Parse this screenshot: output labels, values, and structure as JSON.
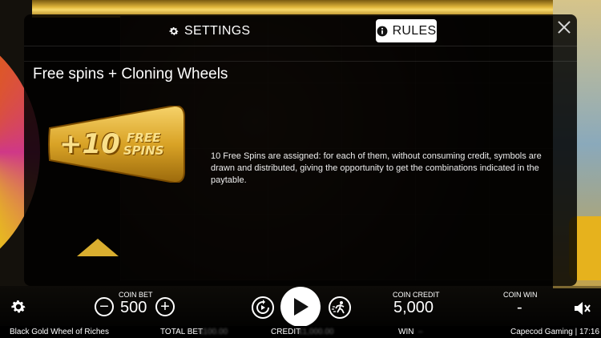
{
  "modal": {
    "tabs": [
      {
        "label": "SETTINGS",
        "icon": "gear-icon",
        "active": false
      },
      {
        "label": "RULES",
        "icon": "info-icon",
        "active": true
      }
    ],
    "close_icon": "close-icon",
    "heading": "Free spins + Cloning Wheels",
    "badge": {
      "number": "+10",
      "word1": "FREE",
      "word2": "SPINS"
    },
    "description": "10 Free Spins are assigned: for each of them, without consuming credit, symbols are drawn and distributed, giving the opportunity to get the combinations indicated in the paytable."
  },
  "controls": {
    "coin_bet_label": "COIN BET",
    "coin_bet_value": "500",
    "minus_label": "−",
    "plus_label": "+",
    "coin_credit_label": "COIN CREDIT",
    "coin_credit_value": "5,000",
    "coin_win_label": "COIN WIN",
    "coin_win_value": "-"
  },
  "status": {
    "game_name": "Black Gold Wheel of Riches",
    "total_bet_label": "TOTAL BET",
    "total_bet_value": "€100.00",
    "credit_label": "CREDIT",
    "credit_value": "€1,000.00",
    "win_label": "WIN",
    "win_value": "–",
    "provider_time": "Capecod Gaming | 17:16"
  },
  "colors": {
    "accent_gold": "#f2c023",
    "modal_bg": "#000000"
  }
}
